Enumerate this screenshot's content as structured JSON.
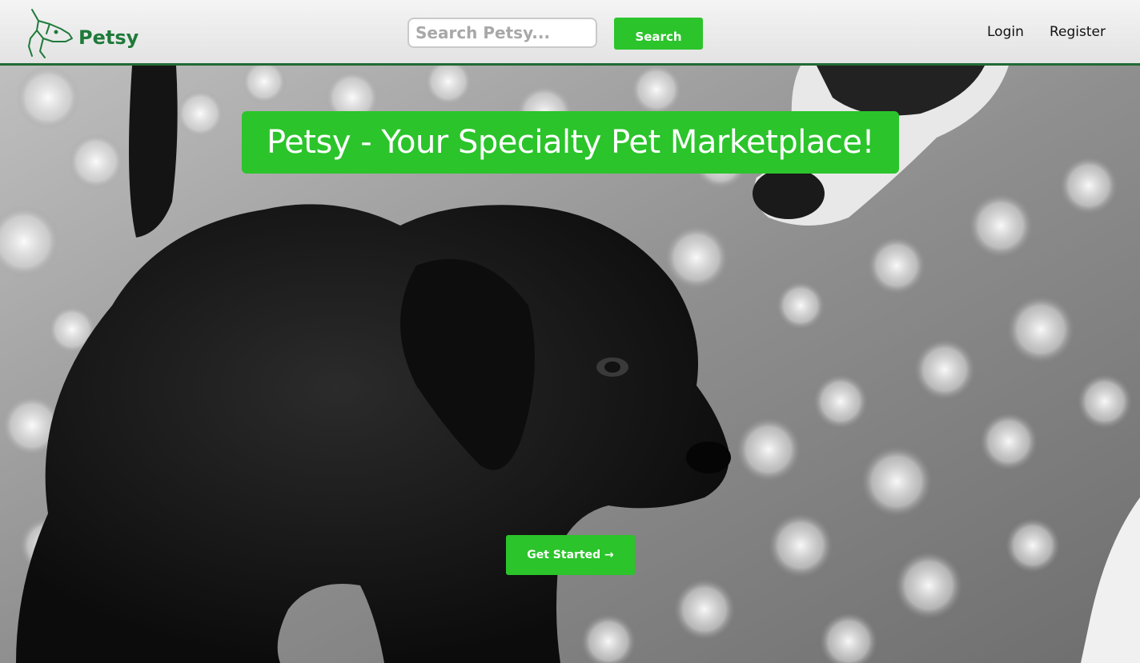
{
  "header": {
    "brand_name": "Petsy",
    "search": {
      "placeholder": "Search Petsy...",
      "value": "",
      "button_label": "Search"
    },
    "nav": {
      "login_label": "Login",
      "register_label": "Register"
    }
  },
  "hero": {
    "title": "Petsy - Your Specialty Pet Marketplace!",
    "cta_label": "Get Started →",
    "image": "black-puppy-photo"
  },
  "colors": {
    "accent": "#2bc42b",
    "brand": "#1f7a3a",
    "navbar_border": "#1f6b33"
  },
  "icons": {
    "logo": "dog-head-icon"
  }
}
